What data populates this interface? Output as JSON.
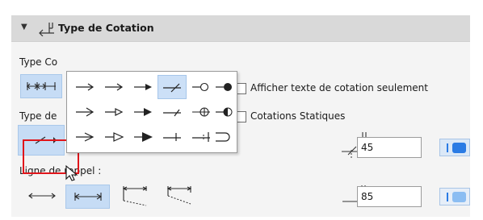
{
  "section": {
    "title": "Type de Cotation",
    "collapse_icon": "triangle-down-icon",
    "header_icon": "dimension-type-icon"
  },
  "labels": {
    "type_cotation_partial": "Type Co",
    "type_de_partial": "Type de",
    "ligne_de_rappel": "Ligne de rappel :"
  },
  "checkboxes": [
    {
      "label": "Afficher texte de cotation seulement",
      "checked": false
    },
    {
      "label": "Cotations Statiques",
      "checked": false
    }
  ],
  "popup": {
    "rows": [
      [
        "arrow-open-icon",
        "arrow-open-triangle-icon",
        "arrow-filled-icon",
        "slash-tick-icon",
        "circle-open-icon",
        "circle-filled-icon"
      ],
      [
        "arrow-open-long-icon",
        "arrow-hollow-triangle-icon",
        "arrow-filled-long-icon",
        "slash-tick-short-icon",
        "circle-cross-icon",
        "circle-half-filled-icon"
      ],
      [
        "arrow-open-wide-icon",
        "arrow-hollow-wide-icon",
        "arrow-filled-wide-icon",
        "tick-bar-icon",
        "double-tick-bar-icon",
        "bracket-round-icon"
      ]
    ],
    "selected": "slash-tick-icon"
  },
  "inputs": {
    "text_offset_value": "45",
    "witness_offset_value": "85"
  },
  "colors": {
    "accent": "#2a7be4",
    "selection": "#c6dcf5",
    "highlight_box": "#e0151b"
  }
}
